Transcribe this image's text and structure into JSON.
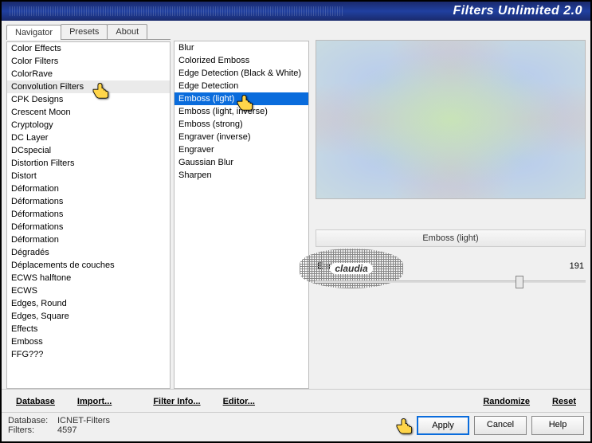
{
  "title": "Filters Unlimited 2.0",
  "tabs": [
    "Navigator",
    "Presets",
    "About"
  ],
  "activeTab": 0,
  "categories": [
    "Color Effects",
    "Color Filters",
    "ColorRave",
    "Convolution Filters",
    "CPK Designs",
    "Crescent Moon",
    "Cryptology",
    "DC Layer",
    "DCspecial",
    "Distortion Filters",
    "Distort",
    "Déformation",
    "Déformations",
    "Déformations",
    "Déformations",
    "Déformation",
    "Dégradés",
    "Déplacements de couches",
    "ECWS halftone",
    "ECWS",
    "Edges, Round",
    "Edges, Square",
    "Effects",
    "Emboss",
    "FFG???"
  ],
  "selectedCategoryIndex": 3,
  "filters": [
    "Blur",
    "Colorized Emboss",
    "Edge Detection (Black & White)",
    "Edge Detection",
    "Emboss (light)",
    "Emboss (light, inverse)",
    "Emboss (strong)",
    "Engraver (inverse)",
    "Engraver",
    "Gaussian Blur",
    "Sharpen"
  ],
  "selectedFilterIndex": 4,
  "watermark": "claudia",
  "currentFilterName": "Emboss (light)",
  "param": {
    "name": "Emboss",
    "value": "191"
  },
  "toolbar": {
    "database": "Database",
    "import": "Import...",
    "filterInfo": "Filter Info...",
    "editor": "Editor...",
    "randomize": "Randomize",
    "reset": "Reset"
  },
  "status": {
    "dbLabel": "Database:",
    "dbValue": "ICNET-Filters",
    "filtersLabel": "Filters:",
    "filtersValue": "4597"
  },
  "buttons": {
    "apply": "Apply",
    "cancel": "Cancel",
    "help": "Help"
  }
}
